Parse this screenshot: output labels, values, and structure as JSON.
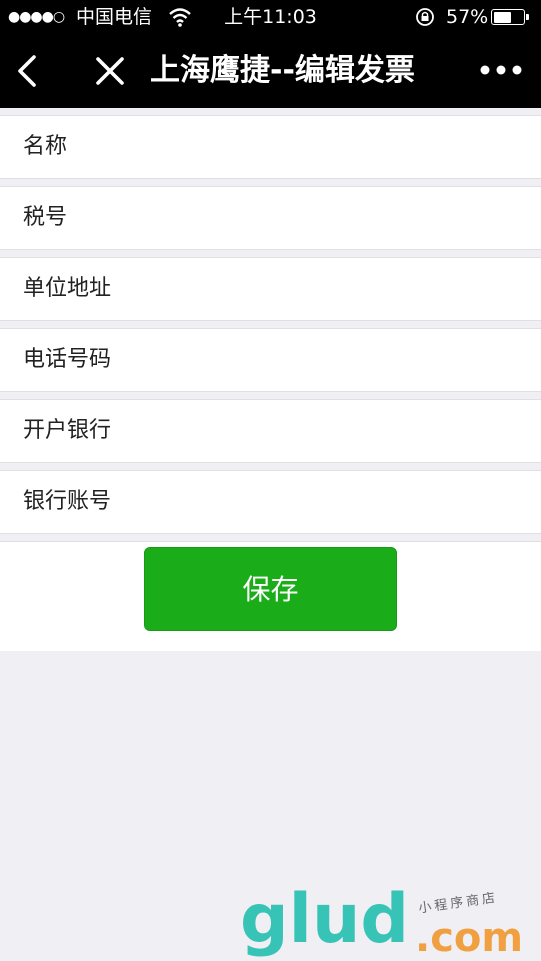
{
  "status_bar": {
    "signal": "●●●●○",
    "carrier": "中国电信",
    "time": "上午11:03",
    "battery_percent": "57%",
    "battery_level": 0.57
  },
  "nav": {
    "title": "上海鹰捷--编辑发票"
  },
  "form": {
    "fields": [
      {
        "label": "名称",
        "value": ""
      },
      {
        "label": "税号",
        "value": ""
      },
      {
        "label": "单位地址",
        "value": ""
      },
      {
        "label": "电话号码",
        "value": ""
      },
      {
        "label": "开户银行",
        "value": ""
      },
      {
        "label": "银行账号",
        "value": ""
      }
    ],
    "save_label": "保存"
  },
  "watermark": {
    "brand": "glud",
    "suffix": ".com",
    "tagline": "小程序商店"
  },
  "colors": {
    "nav_bg": "#000000",
    "page_bg": "#efeff4",
    "primary_green": "#1aad19"
  }
}
